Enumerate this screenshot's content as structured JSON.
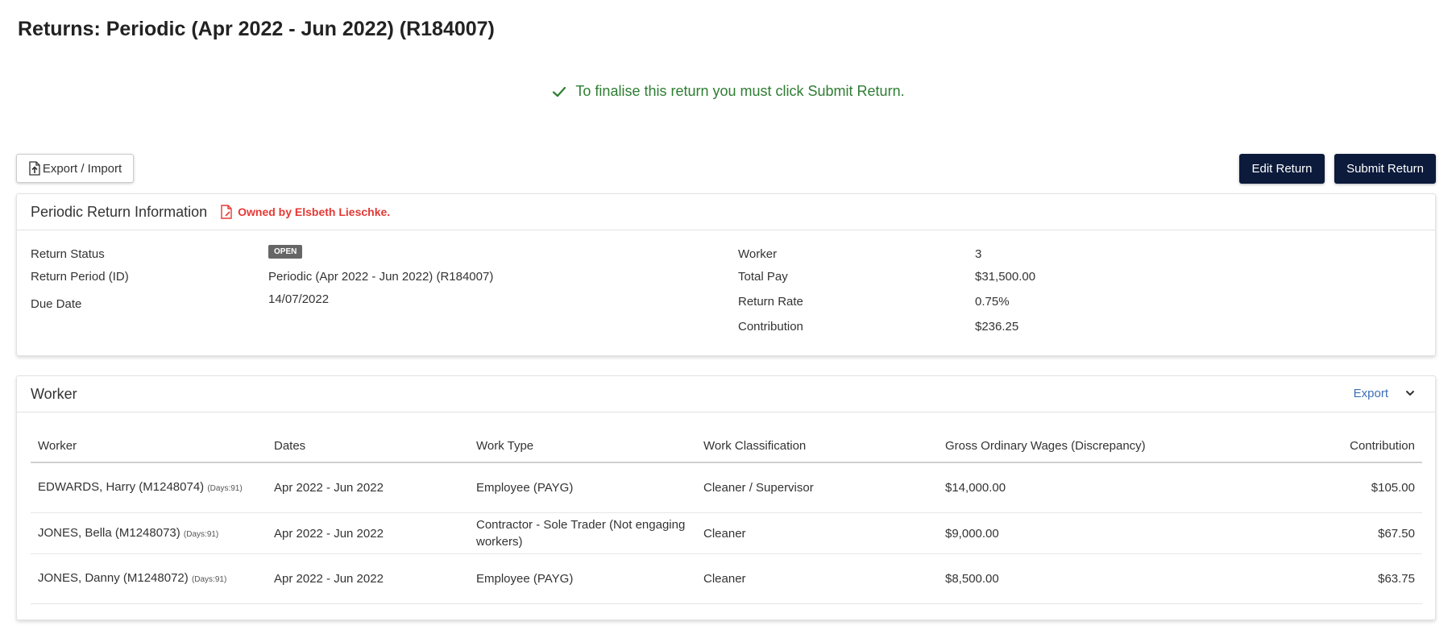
{
  "page": {
    "title": "Returns: Periodic (Apr 2022 - Jun 2022) (R184007)",
    "notice": "To finalise this return you must click Submit Return.",
    "notice_color": "#2e7d32"
  },
  "toolbar": {
    "export_import_label": "Export / Import",
    "edit_label": "Edit Return",
    "submit_label": "Submit Return",
    "primary_color": "#0c1a3b"
  },
  "info_panel": {
    "title": "Periodic Return Information",
    "owner": "Owned by Elsbeth Lieschke.",
    "owner_color": "#e53935",
    "left": {
      "status_label": "Return Status",
      "status_value": "OPEN",
      "period_label": "Return Period (ID)",
      "period_value": "Periodic (Apr 2022 - Jun 2022) (R184007)",
      "due_label": "Due Date",
      "due_value": "14/07/2022"
    },
    "right": {
      "worker_label": "Worker",
      "worker_value": "3",
      "total_pay_label": "Total Pay",
      "total_pay_value": "$31,500.00",
      "rate_label": "Return Rate",
      "rate_value": "0.75%",
      "contribution_label": "Contribution",
      "contribution_value": "$236.25"
    }
  },
  "worker_panel": {
    "title": "Worker",
    "export_label": "Export",
    "columns": [
      "Worker",
      "Dates",
      "Work Type",
      "Work Classification",
      "Gross Ordinary Wages (Discrepancy)",
      "Contribution"
    ],
    "rows": [
      {
        "name": "EDWARDS, Harry (M1248074)",
        "days": "(Days:91)",
        "dates": "Apr 2022 - Jun 2022",
        "work_type": "Employee (PAYG)",
        "classification": "Cleaner / Supervisor",
        "wages": "$14,000.00",
        "contribution": "$105.00"
      },
      {
        "name": "JONES, Bella (M1248073)",
        "days": "(Days:91)",
        "dates": "Apr 2022 - Jun 2022",
        "work_type": "Contractor - Sole Trader (Not engaging workers)",
        "classification": "Cleaner",
        "wages": "$9,000.00",
        "contribution": "$67.50"
      },
      {
        "name": "JONES, Danny (M1248072)",
        "days": "(Days:91)",
        "dates": "Apr 2022 - Jun 2022",
        "work_type": "Employee (PAYG)",
        "classification": "Cleaner",
        "wages": "$8,500.00",
        "contribution": "$63.75"
      }
    ]
  },
  "icons": {
    "notice": "check-icon",
    "export_import": "file-upload-icon",
    "owner": "document-edit-icon",
    "collapse": "chevron-down-icon"
  }
}
